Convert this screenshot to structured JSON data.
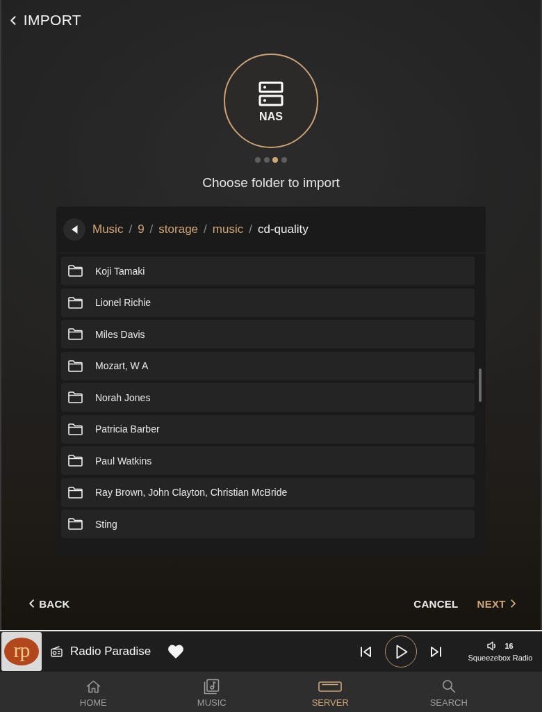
{
  "header": {
    "title": "IMPORT"
  },
  "source": {
    "label": "NAS"
  },
  "steps": [
    {
      "selected": false
    },
    {
      "selected": false
    },
    {
      "selected": true
    },
    {
      "selected": false
    }
  ],
  "heading": "Choose folder to import",
  "path": [
    {
      "kind": "link",
      "text": "Music"
    },
    {
      "kind": "separator",
      "text": "/"
    },
    {
      "kind": "link",
      "text": "9"
    },
    {
      "kind": "separator",
      "text": "/"
    },
    {
      "kind": "link",
      "text": "storage"
    },
    {
      "kind": "separator",
      "text": "/"
    },
    {
      "kind": "link",
      "text": "music"
    },
    {
      "kind": "separator",
      "text": "/"
    },
    {
      "kind": "current",
      "text": "cd-quality"
    }
  ],
  "folders": [
    "Koji Tamaki",
    "Lionel Richie",
    "Miles Davis",
    "Mozart, W A",
    "Norah Jones",
    "Patricia Barber",
    "Paul Watkins",
    "Ray Brown, John Clayton, Christian McBride",
    "Sting"
  ],
  "actions": {
    "back": "BACK",
    "cancel": "CANCEL",
    "next": "NEXT"
  },
  "now_playing": {
    "logo_text": "rp",
    "station": "Radio Paradise",
    "favorite": true,
    "playing": false,
    "volume": "16",
    "player": "Squeezebox Radio"
  },
  "nav": [
    {
      "kind": "home",
      "label": "HOME",
      "selected": false
    },
    {
      "kind": "music",
      "label": "MUSIC",
      "selected": false
    },
    {
      "kind": "server",
      "label": "SERVER",
      "selected": true
    },
    {
      "kind": "search",
      "label": "SEARCH",
      "selected": false
    }
  ]
}
